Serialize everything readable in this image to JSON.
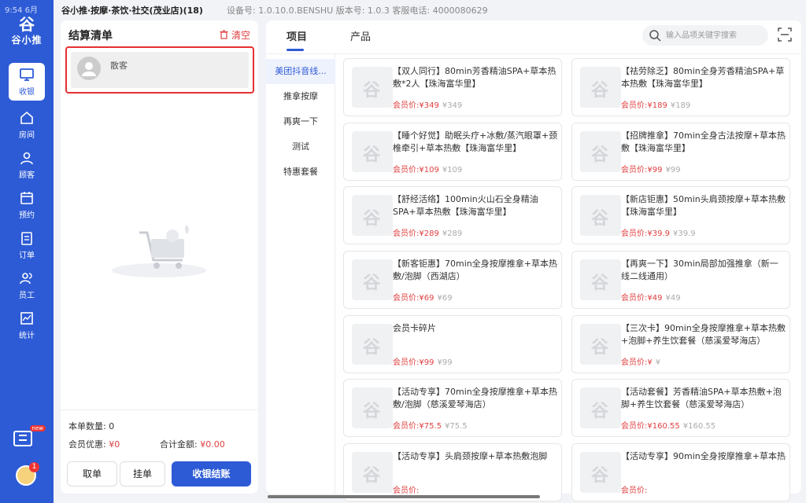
{
  "status": {
    "time": "9:54  6月"
  },
  "topbar": {
    "store": "谷小推·按摩·茶饮·社交(茂业店)(18)",
    "info": "设备号: 1.0.10.0.BENSHU   版本号:  1.0.3   客服电话:  4000080629"
  },
  "brand": {
    "logo_mark": "谷",
    "logo_text": "谷小推"
  },
  "nav": [
    {
      "label": "收银",
      "icon": "monitor-icon",
      "active": true
    },
    {
      "label": "房间",
      "icon": "home-icon"
    },
    {
      "label": "顾客",
      "icon": "user-icon"
    },
    {
      "label": "预约",
      "icon": "calendar-icon"
    },
    {
      "label": "订单",
      "icon": "document-icon"
    },
    {
      "label": "员工",
      "icon": "staff-icon"
    },
    {
      "label": "统计",
      "icon": "chart-icon"
    }
  ],
  "nav_bottom": {
    "promo_label": "new",
    "avatar_badge": "1"
  },
  "checkout": {
    "title": "结算清单",
    "clear": "清空",
    "customer": "散客",
    "count_label": "本单数量:",
    "count_value": "0",
    "discount_label": "会员优惠:",
    "discount_value": "¥0",
    "total_label": "合计金额:",
    "total_value": "¥0.00",
    "btn_pick": "取单",
    "btn_hang": "挂单",
    "btn_checkout": "收银结账"
  },
  "tabs": [
    "项目",
    "产品"
  ],
  "search": {
    "placeholder": "输入品项关键字搜索"
  },
  "categories": [
    "美团抖音线...",
    "推拿按摩",
    "再爽一下",
    "测试",
    "特惠套餐"
  ],
  "price_label": "会员价:",
  "products": [
    {
      "name": "【双人同行】80min芳香精油SPA+草本热敷*2人【珠海富华里】",
      "price": "¥349",
      "orig": "¥349"
    },
    {
      "name": "【祛劳除乏】80min全身芳香精油SPA+草本热敷【珠海富华里】",
      "price": "¥189",
      "orig": "¥189"
    },
    {
      "name": "【睡个好觉】助眠头疗+冰敷/蒸汽眼罩+颈椎牵引+草本热敷【珠海富华里】",
      "price": "¥109",
      "orig": "¥109"
    },
    {
      "name": "【招牌推拿】70min全身古法按摩+草本热敷【珠海富华里】",
      "price": "¥99",
      "orig": "¥99"
    },
    {
      "name": "【舒经活络】100min火山石全身精油SPA+草本热敷【珠海富华里】",
      "price": "¥289",
      "orig": "¥289"
    },
    {
      "name": "【新店钜惠】50min头肩颈按摩+草本热敷【珠海富华里】",
      "price": "¥39.9",
      "orig": "¥39.9"
    },
    {
      "name": "【新客钜惠】70min全身按摩推拿+草本热敷/泡脚（西湖店）",
      "price": "¥69",
      "orig": "¥69"
    },
    {
      "name": "【再爽一下】30min局部加强推拿（新一线二线通用）",
      "price": "¥49",
      "orig": "¥49"
    },
    {
      "name": "会员卡碎片",
      "price": "¥99",
      "orig": "¥99"
    },
    {
      "name": "【三次卡】90min全身按摩推拿+草本热敷+泡脚+养生饮套餐（慈溪爱琴海店）",
      "price": "¥",
      "orig": "¥"
    },
    {
      "name": "【活动专享】70min全身按摩推拿+草本热敷/泡脚（慈溪爱琴海店）",
      "price": "¥75.5",
      "orig": "¥75.5"
    },
    {
      "name": "【活动套餐】芳香精油SPA+草本热敷+泡脚+养生饮套餐（慈溪爱琴海店）",
      "price": "¥160.55",
      "orig": "¥160.55"
    },
    {
      "name": "【活动专享】头肩颈按摩+草本热敷泡脚",
      "price": "",
      "orig": ""
    },
    {
      "name": "【活动专享】90min全身按摩推拿+草本热",
      "price": "",
      "orig": ""
    }
  ]
}
